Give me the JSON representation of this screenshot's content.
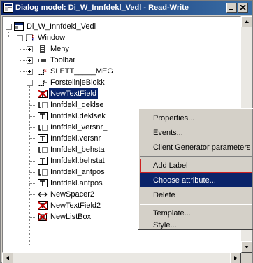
{
  "window": {
    "title": "Dialog model: Di_W_Innfdekl_Vedl - Read-Write"
  },
  "tree": {
    "nodes": [
      {
        "label": "Di_W_Innfdekl_Vedl",
        "icon": "dialog-model-icon"
      },
      {
        "label": "Window",
        "icon": "window-icon"
      },
      {
        "label": "Meny",
        "icon": "menu-icon"
      },
      {
        "label": "Toolbar",
        "icon": "toolbar-icon"
      },
      {
        "label": "SLETT_____MEG",
        "icon": "container-icon"
      },
      {
        "label": "ForstelinjeBlokk",
        "icon": "container-icon"
      },
      {
        "label": "NewTextField",
        "icon": "text-field-error-icon"
      },
      {
        "label": "Innfdekl_deklse",
        "icon": "label-icon"
      },
      {
        "label": "Innfdekl.deklsek",
        "icon": "text-field-icon"
      },
      {
        "label": "Innfdekl_versnr_",
        "icon": "label-icon"
      },
      {
        "label": "Innfdekl.versnr",
        "icon": "text-field-icon"
      },
      {
        "label": "Innfdekl_behsta",
        "icon": "label-icon"
      },
      {
        "label": "Innfdekl.behstat",
        "icon": "text-field-icon"
      },
      {
        "label": "Innfdekl_antpos",
        "icon": "label-icon"
      },
      {
        "label": "Innfdekl.antpos",
        "icon": "text-field-icon"
      },
      {
        "label": "NewSpacer2",
        "icon": "spacer-icon"
      },
      {
        "label": "NewTextField2",
        "icon": "text-field-error-icon"
      },
      {
        "label": "NewListBox",
        "icon": "list-box-error-icon"
      }
    ]
  },
  "context_menu": {
    "items": [
      {
        "label": "Properties..."
      },
      {
        "label": "Events..."
      },
      {
        "label": "Client Generator parameters"
      },
      {
        "label": "Add Label"
      },
      {
        "label": "Choose attribute..."
      },
      {
        "label": "Delete"
      },
      {
        "label": "Template..."
      },
      {
        "label": "Style..."
      }
    ]
  },
  "colors": {
    "title_bar": "#0a246a",
    "selection": "#0a246a",
    "error_icon": "#cc0000",
    "highlight_outline": "#cc2222"
  }
}
